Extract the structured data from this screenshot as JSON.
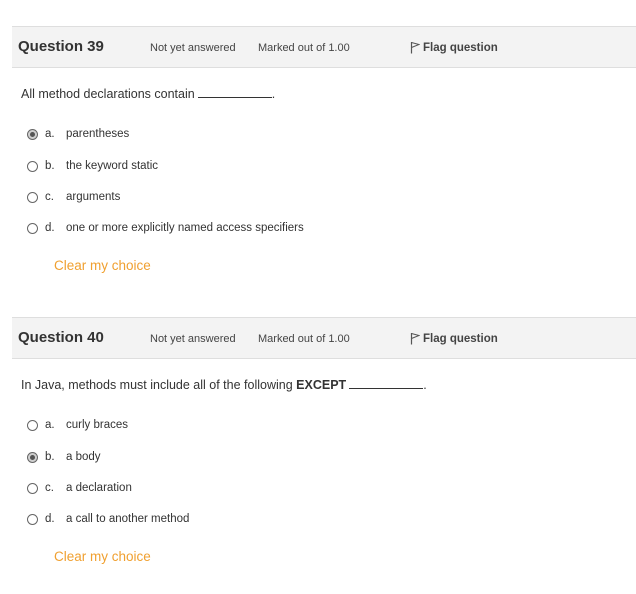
{
  "questions": [
    {
      "title": "Question 39",
      "status": "Not yet answered",
      "marks": "Marked out of 1.00",
      "flag_label": "Flag question",
      "text_before": "All method declarations contain",
      "text_bold": "",
      "text_after": ".",
      "options": [
        {
          "letter": "a.",
          "text": "parentheses",
          "checked": true
        },
        {
          "letter": "b.",
          "text": "the keyword static",
          "checked": false
        },
        {
          "letter": "c.",
          "text": "arguments",
          "checked": false
        },
        {
          "letter": "d.",
          "text": "one or more explicitly named access specifiers",
          "checked": false
        }
      ],
      "clear_label": "Clear my choice"
    },
    {
      "title": "Question 40",
      "status": "Not yet answered",
      "marks": "Marked out of 1.00",
      "flag_label": "Flag question",
      "text_before": "In Java, methods must include all of the following",
      "text_bold": "EXCEPT",
      "text_after": ".",
      "options": [
        {
          "letter": "a.",
          "text": "curly braces",
          "checked": false
        },
        {
          "letter": "b.",
          "text": "a body",
          "checked": true
        },
        {
          "letter": "c.",
          "text": "a declaration",
          "checked": false
        },
        {
          "letter": "d.",
          "text": "a call to another method",
          "checked": false
        }
      ],
      "clear_label": "Clear my choice"
    }
  ],
  "colors": {
    "link": "#f0a030",
    "header_bg": "#f3f3f3"
  },
  "icons": {
    "flag": "flag-icon"
  }
}
